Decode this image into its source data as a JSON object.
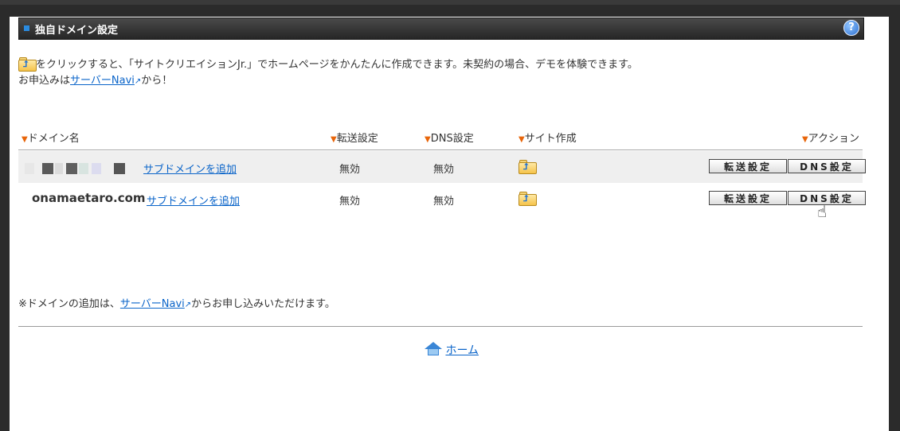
{
  "panel": {
    "title": "独自ドメイン設定",
    "help_label": "?"
  },
  "intro": {
    "line1": "をクリックすると、「サイトクリエイションJr.」でホームページをかんたんに作成できます。未契約の場合、デモを体験できます。",
    "line2_prefix": "お申込みは",
    "link": "サーバーNavi",
    "line2_suffix": "から！"
  },
  "table": {
    "headers": {
      "domain": "ドメイン名",
      "forward": "転送設定",
      "dns": "DNS設定",
      "site": "サイト作成",
      "action": "アクション"
    },
    "rows": [
      {
        "domain": "",
        "add_subdomain": "サブドメインを追加",
        "forward": "無効",
        "dns": "無効",
        "btn_forward": "転送設定",
        "btn_dns": "DNS設定"
      },
      {
        "domain": "onamaetaro.com",
        "add_subdomain": "サブドメインを追加",
        "forward": "無効",
        "dns": "無効",
        "btn_forward": "転送設定",
        "btn_dns": "DNS設定"
      }
    ]
  },
  "note": {
    "prefix": "※ドメインの追加は、",
    "link": "サーバーNavi",
    "suffix": "からお申し込みいただけます。"
  },
  "footer": {
    "home": "ホーム"
  },
  "icons": {
    "external_link": "↗",
    "triangle": "▼",
    "cursor": "☝"
  }
}
